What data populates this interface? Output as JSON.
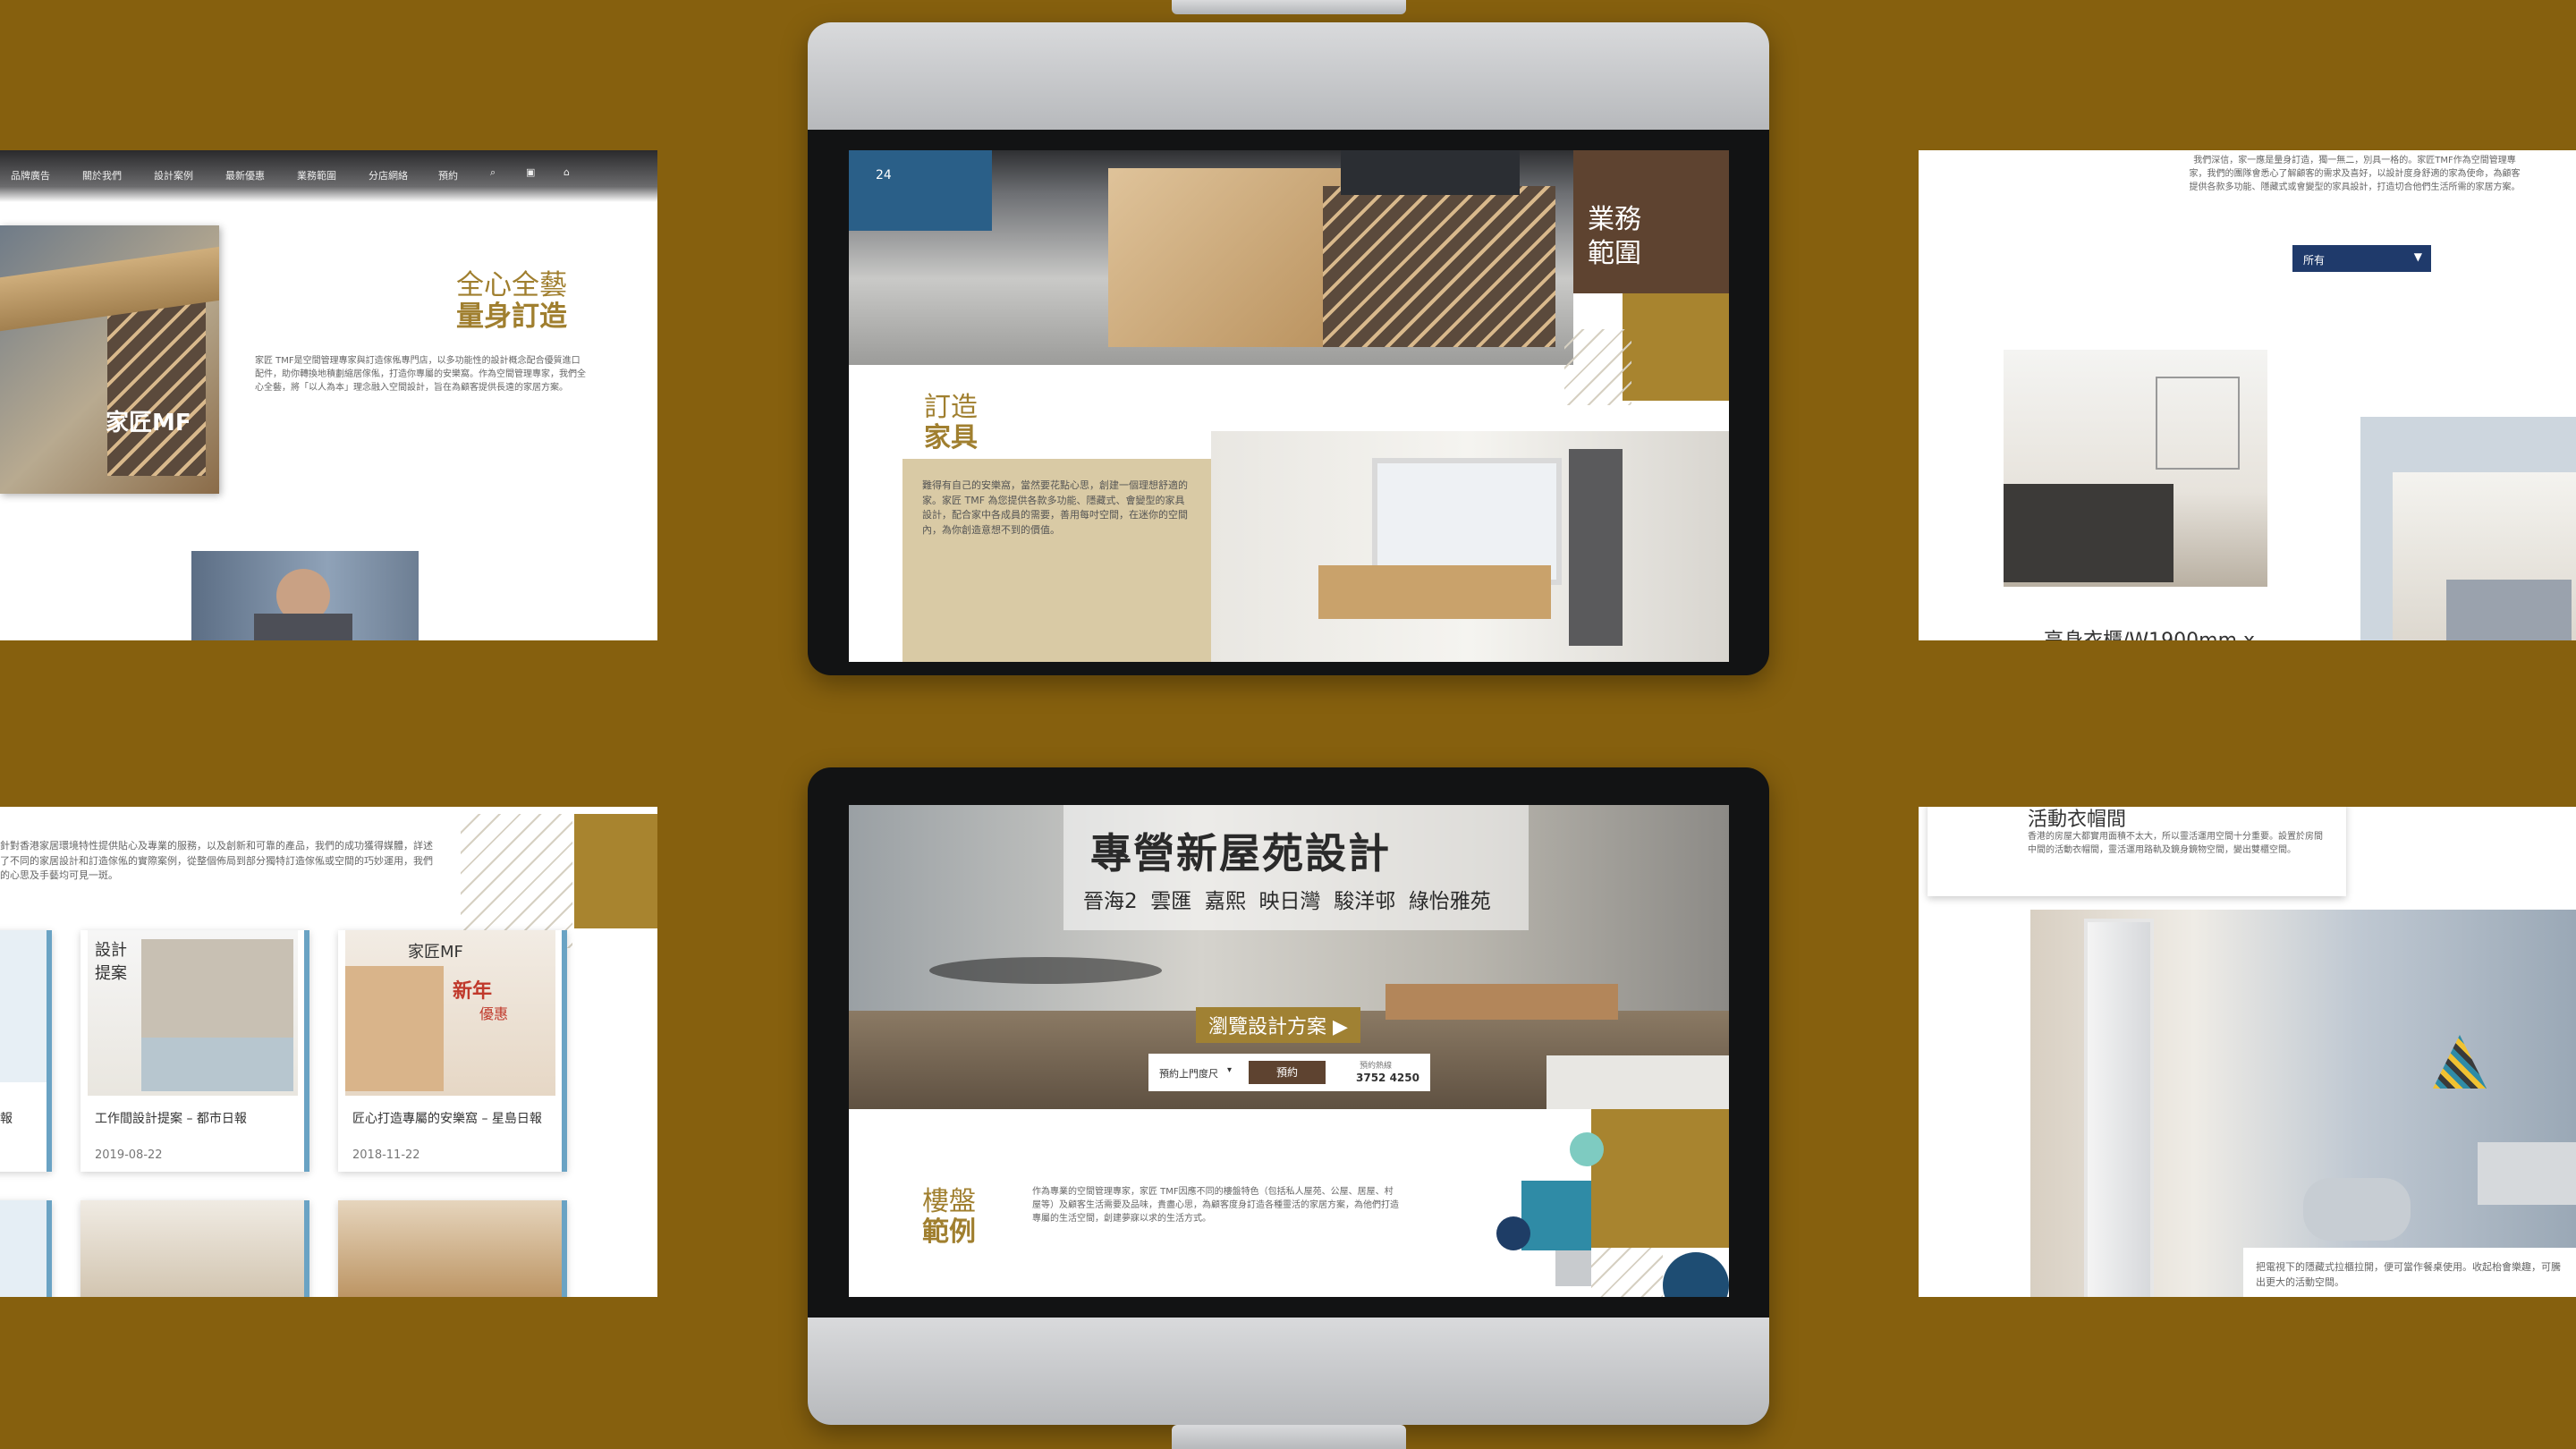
{
  "panel_tl": {
    "nav": [
      "品牌廣告",
      "關於我們",
      "設計案例",
      "最新優惠",
      "業務範圍",
      "分店網絡",
      "預約"
    ],
    "heading_line1": "全心全藝",
    "heading_line2": "量身訂造",
    "body": "家匠 TMF是空間管理專家與訂造傢俬專門店，以多功能性的設計概念配合優質進口配件，助你轉換地積劃縮居傢俬，打造你專屬的安樂窩。作為空間管理專家，我們全心全藝，將「以人為本」理念融入空間設計，旨在為顧客提供長遠的家居方案。",
    "store_sign": "家匠MF"
  },
  "monitor_top": {
    "service_heading_1": "業務",
    "service_heading_2": "範圍",
    "furniture_heading_1": "訂造",
    "furniture_heading_2": "家具",
    "furniture_body": "難得有自己的安樂窩，當然要花點心思，創建一個理想舒適的家。家匠 TMF 為您提供各款多功能、隱藏式、會變型的家具設計，配合家中各成員的需要，善用每吋空間，在迷你的空間內，為你創造意想不到的價值。",
    "signage": "24"
  },
  "panel_tr": {
    "body": "我們深信，家一應是量身訂造，獨一無二，別具一格的。家匠TMF作為空間管理專家，我們的團隊會悉心了解顧客的需求及喜好，以設計度身舒適的家為使命，為顧客提供各款多功能、隱藏式或會變型的家具設計，打造切合他們生活所需的家居方案。",
    "select_value": "所有",
    "caption": "高身衣櫃/W1900mm x"
  },
  "panel_bl": {
    "intro": "針對香港家居環境特性提供貼心及專業的服務，以及創新和可靠的產品，我們的成功獲得媒體，詳述了不同的家居設計和訂造傢俬的實際案例，從整個佈局到部分獨特訂造傢俬或空間的巧妙運用，我們的心思及手藝均可見一斑。",
    "cards": [
      {
        "title": "工作間設計提案 – 都市日報",
        "date": "2019-08-22"
      },
      {
        "title": "匠心打造專屬的安樂窩 – 星島日報",
        "date": "2018-11-22"
      }
    ],
    "left_card_label": "報",
    "newspaper_header_1": "設計提案",
    "newspaper_header_2": "家匠MF",
    "newspaper_header_3": "新年",
    "newspaper_header_4": "優惠"
  },
  "monitor_bottom": {
    "banner_title": "專營新屋苑設計",
    "banner_estates": "晉海2  雲匯  嘉熙  映日灣  駿洋邨  綠怡雅苑",
    "browse_button": "瀏覽設計方案 ▶",
    "booking_select": "預約上門度尺",
    "booking_button": "預約",
    "hotline_label": "預約熱線",
    "hotline_number": "3752 4250",
    "estate_heading_1": "樓盤",
    "estate_heading_2": "範例",
    "estate_body": "作為專業的空間管理專家，家匠 TMF因應不同的樓盤特色（包括私人屋苑、公屋、居屋、村屋等）及顧客生活需要及品味，貴盡心思，為顧客度身訂造各種靈活的家居方案，為他們打造專屬的生活空間，創建夢寐以求的生活方式。"
  },
  "panel_br": {
    "heading": "活動衣帽間",
    "body": "香港的房屋大都實用面積不太大，所以靈活運用空間十分重要。設置於房間中間的活動衣帽間，靈活運用路軌及鏡身鏡物空間，變出雙櫃空間。",
    "caption": "把電視下的隱藏式拉櫃拉開，便可當作餐桌使用。收起枱會樂趣，可騰出更大的活動空間。"
  },
  "colors": {
    "background": "#86600e",
    "gold": "#a07f2f",
    "brown": "#5e4330",
    "navy": "#1f3a6b"
  }
}
